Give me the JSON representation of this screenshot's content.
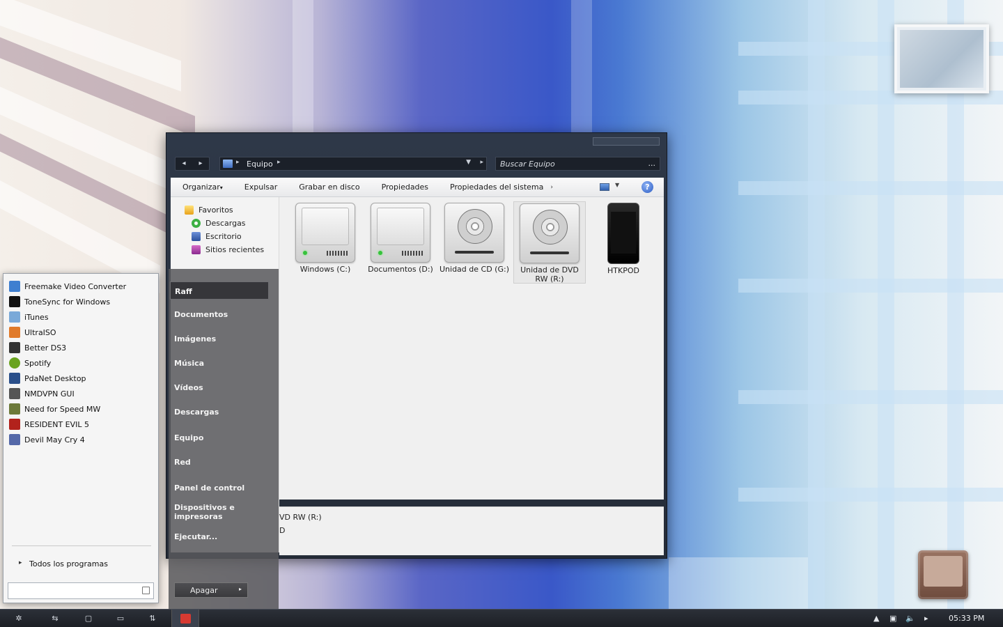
{
  "explorer": {
    "address": {
      "location": "Equipo"
    },
    "search_placeholder": "Buscar Equipo",
    "search_more": "...",
    "commands": [
      "Organizar",
      "Expulsar",
      "Grabar en disco",
      "Propiedades",
      "Propiedades del sistema"
    ],
    "organize_arrow": "▾",
    "more_commands": "›",
    "help": "?",
    "nav_pane": [
      {
        "label": "Favoritos",
        "icon": "star-folder-icon"
      },
      {
        "label": "Descargas",
        "icon": "download-icon"
      },
      {
        "label": "Escritorio",
        "icon": "desktop-icon"
      },
      {
        "label": "Sitios recientes",
        "icon": "recent-icon"
      }
    ],
    "drives": [
      {
        "label": "Windows (C:)",
        "icon": "hard-drive-icon"
      },
      {
        "label": "Documentos (D:)",
        "icon": "hard-drive-icon"
      },
      {
        "label": "Unidad de CD (G:)",
        "icon": "optical-drive-icon"
      },
      {
        "label": "Unidad de DVD RW (R:)",
        "icon": "optical-drive-icon",
        "selected": true
      },
      {
        "label": "HTKPOD",
        "icon": "ipod-icon"
      }
    ],
    "details": {
      "line1": "VD RW (R:)",
      "line2": "D"
    }
  },
  "start_menu": {
    "programs": [
      {
        "label": "Freemake Video Converter",
        "color": "#3f7fd0"
      },
      {
        "label": "ToneSync for Windows",
        "color": "#111111"
      },
      {
        "label": "iTunes",
        "color": "#7aa9d8"
      },
      {
        "label": "UltraISO",
        "color": "#e07a2a"
      },
      {
        "label": "Better DS3",
        "color": "#333333"
      },
      {
        "label": "Spotify",
        "color": "#6aa31f"
      },
      {
        "label": "PdaNet Desktop",
        "color": "#2a4f8a"
      },
      {
        "label": "NMDVPN GUI",
        "color": "#555555"
      },
      {
        "label": "Need for Speed MW",
        "color": "#6d7a3a"
      },
      {
        "label": "RESIDENT EVIL 5",
        "color": "#b2221c"
      },
      {
        "label": "Devil May Cry 4",
        "color": "#5468a8"
      }
    ],
    "all_programs": "Todos los programas",
    "all_programs_arrow": "▸",
    "search_value": "",
    "places": [
      "Raff",
      "Documentos",
      "Imágenes",
      "Música",
      "Vídeos",
      "Descargas",
      "Equipo",
      "Red",
      "Panel de control",
      "Dispositivos e impresoras",
      "Ejecutar..."
    ],
    "shutdown": "Apagar",
    "shutdown_arrow": "▸"
  },
  "taskbar": {
    "clock": "05:33 PM",
    "tray_arrow": "▲"
  }
}
